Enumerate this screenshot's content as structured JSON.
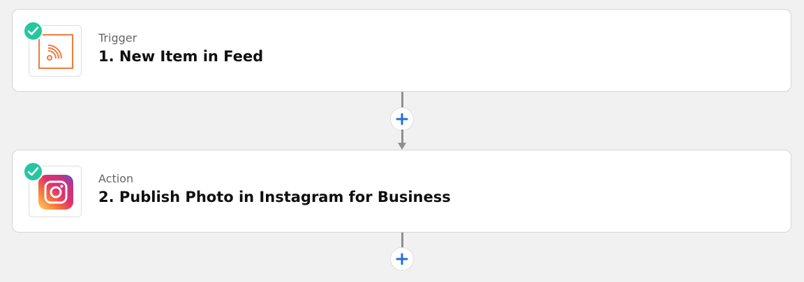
{
  "steps": [
    {
      "kind": "Trigger",
      "title": "1. New Item in Feed",
      "app_icon": "rss-feed-icon",
      "status_icon": "check-icon"
    },
    {
      "kind": "Action",
      "title": "2. Publish Photo in Instagram for Business",
      "app_icon": "instagram-icon",
      "status_icon": "check-icon"
    }
  ],
  "add_step_icon": "plus-icon",
  "colors": {
    "background": "#f1f1f1",
    "card": "#ffffff",
    "check_badge": "#25c7a0",
    "rss_orange": "#f07b3c",
    "plus_blue": "#1f6fe0",
    "connector": "#8f8f8f"
  }
}
